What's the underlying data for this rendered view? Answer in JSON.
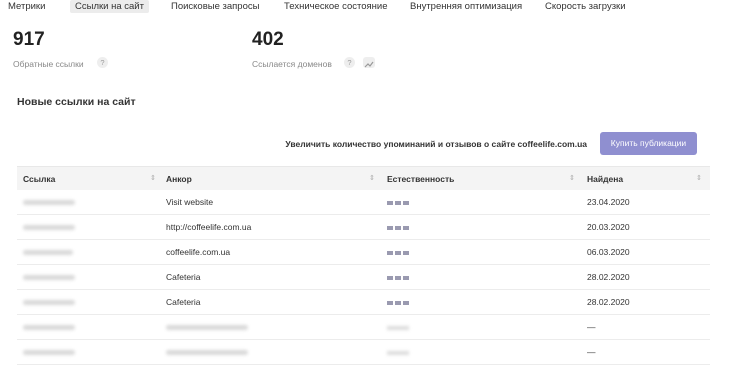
{
  "tabs": [
    {
      "label": "Метрики",
      "active": false
    },
    {
      "label": "Ссылки на сайт",
      "active": true
    },
    {
      "label": "Поисковые запросы",
      "active": false
    },
    {
      "label": "Техническое состояние",
      "active": false
    },
    {
      "label": "Внутренняя оптимизация",
      "active": false
    },
    {
      "label": "Скорость загрузки",
      "active": false
    }
  ],
  "stats": {
    "backlinks": {
      "value": "917",
      "label": "Обратные ссылки",
      "help": "?"
    },
    "domains": {
      "value": "402",
      "label": "Ссылается доменов",
      "help": "?",
      "chart_icon": "chart-icon"
    }
  },
  "section_title": "Новые ссылки на сайт",
  "promo": {
    "text": "Увеличить количество упоминаний и отзывов о сайте coffeelife.com.ua",
    "button_label": "Купить публикации",
    "button_color": "#8f8fd0"
  },
  "table": {
    "headers": [
      "Ссылка",
      "Анкор",
      "Естественность",
      "Найдена"
    ],
    "sort_icon": "⇕",
    "rows": [
      {
        "anchor": "Visit website",
        "found": "23.04.2020"
      },
      {
        "anchor": "http://coffeelife.com.ua",
        "found": "20.03.2020"
      },
      {
        "anchor": "coffeelife.com.ua",
        "found": "06.03.2020"
      },
      {
        "anchor": "Cafeteria",
        "found": "28.02.2020"
      },
      {
        "anchor": "Cafeteria",
        "found": "28.02.2020"
      },
      {
        "anchor": "",
        "found": "—"
      },
      {
        "anchor": "",
        "found": "—"
      }
    ]
  }
}
